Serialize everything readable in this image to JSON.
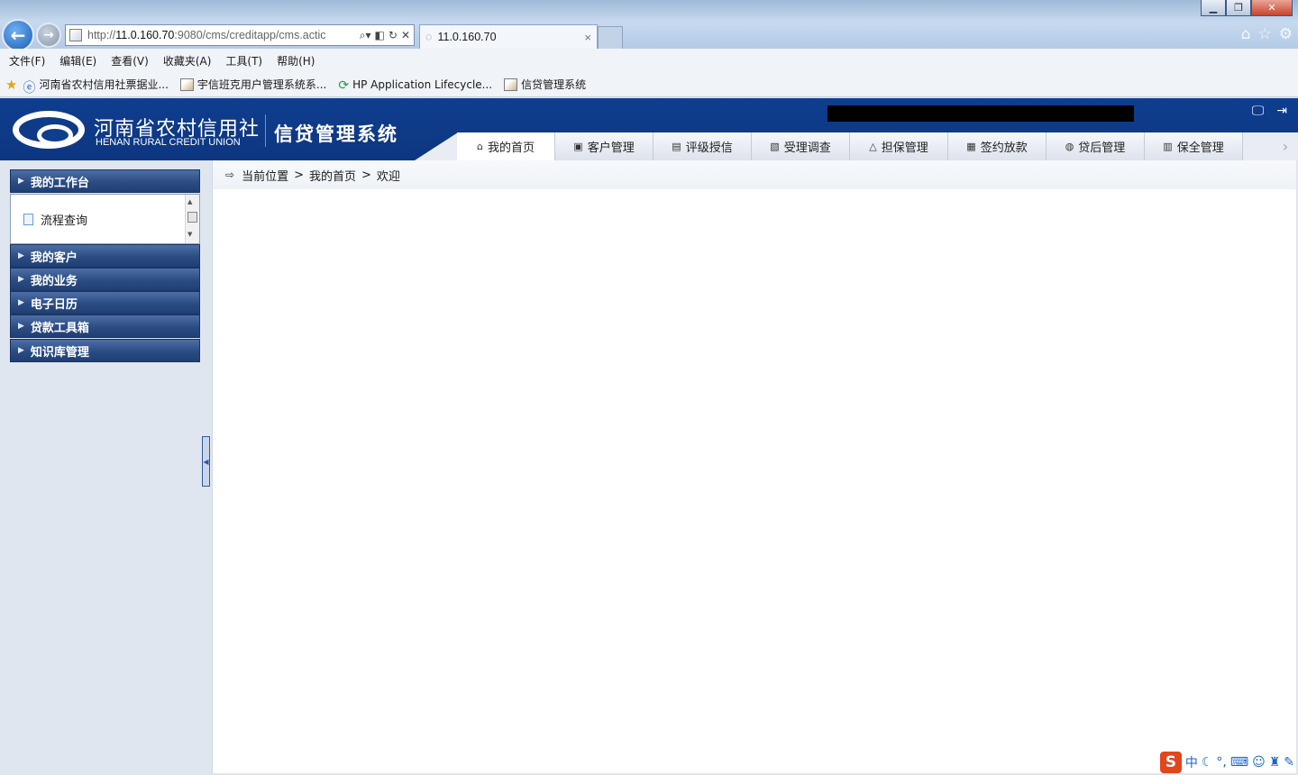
{
  "browser": {
    "window_buttons": {
      "minimize": "▁",
      "restore": "❐",
      "close": "✕"
    },
    "address_prefix": "http://",
    "address_host": "11.0.160.70",
    "address_rest": ":9080/cms/creditapp/cms.actic",
    "tab_title": "11.0.160.70",
    "menu": [
      "文件(F)",
      "编辑(E)",
      "查看(V)",
      "收藏夹(A)",
      "工具(T)",
      "帮助(H)"
    ],
    "favorites": [
      {
        "label": "河南省农村信用社票据业...",
        "icon": "ie-icon"
      },
      {
        "label": "宇信班克用户管理系统系...",
        "icon": "page-icon"
      },
      {
        "label": "HP Application Lifecycle...",
        "icon": "hp-refresh-icon"
      },
      {
        "label": "信贷管理系统",
        "icon": "page-icon"
      }
    ]
  },
  "header": {
    "logo_cn": "河南省农村信用社",
    "logo_en": "HENAN RURAL CREDIT UNION",
    "system_title": "信贷管理系统",
    "nav_tabs": [
      {
        "label": "我的首页",
        "icon": "⌂",
        "active": true
      },
      {
        "label": "客户管理",
        "icon": "▣",
        "active": false
      },
      {
        "label": "评级授信",
        "icon": "▤",
        "active": false
      },
      {
        "label": "受理调查",
        "icon": "▧",
        "active": false
      },
      {
        "label": "担保管理",
        "icon": "△",
        "active": false
      },
      {
        "label": "签约放款",
        "icon": "▦",
        "active": false
      },
      {
        "label": "贷后管理",
        "icon": "◍",
        "active": false
      },
      {
        "label": "保全管理",
        "icon": "▥",
        "active": false
      }
    ]
  },
  "sidebar": {
    "sections": [
      {
        "label": "我的工作台",
        "expanded": true,
        "items": [
          "流程查询"
        ]
      },
      {
        "label": "我的客户"
      },
      {
        "label": "我的业务"
      },
      {
        "label": "电子日历"
      },
      {
        "label": "贷款工具箱"
      },
      {
        "label": "知识库管理"
      }
    ]
  },
  "breadcrumb": {
    "prefix": "当前位置",
    "sep": ">",
    "level1": "我的首页",
    "level2": "欢迎"
  },
  "ime": {
    "logo": "S",
    "mode": "中"
  }
}
